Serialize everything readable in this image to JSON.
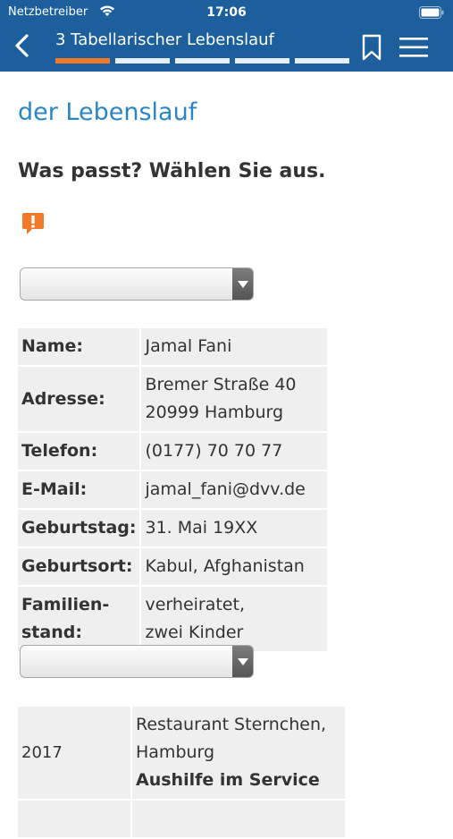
{
  "status_bar": {
    "carrier": "Netzbetreiber",
    "time": "17:06"
  },
  "header": {
    "title": "3 Tabellarischer Lebenslauf",
    "progress_segments": 5,
    "progress_active": 1
  },
  "main": {
    "section_title": "der Lebenslauf",
    "instruction": "Was passt? Wählen Sie aus.",
    "dropdown1_value": "",
    "dropdown2_value": ""
  },
  "personal": {
    "name_label": "Name:",
    "name_value": "Jamal Fani",
    "address_label": "Adresse:",
    "address_line1": "Bremer Straße 40",
    "address_line2": "20999 Hamburg",
    "phone_label": "Telefon:",
    "phone_value": "(0177) 70 70 77",
    "email_label": "E-Mail:",
    "email_value": "jamal_fani@dvv.de",
    "birthday_label": "Geburtstag:",
    "birthday_value": "31. Mai 19XX",
    "birthplace_label": "Geburtsort:",
    "birthplace_value": "Kabul, Afghanistan",
    "family_label_line1": "Familien-",
    "family_label_line2": "stand:",
    "family_value_line1": "verheiratet,",
    "family_value_line2": "zwei Kinder"
  },
  "experience": {
    "year": "2017",
    "place_line1": "Restaurant Sternchen,",
    "place_line2": "Hamburg",
    "role": "Aushilfe im Service"
  },
  "colors": {
    "header_bg": "#1c5f9c",
    "accent": "#f07a28",
    "title_blue": "#2b86c5",
    "cell_bg": "#efefef"
  }
}
